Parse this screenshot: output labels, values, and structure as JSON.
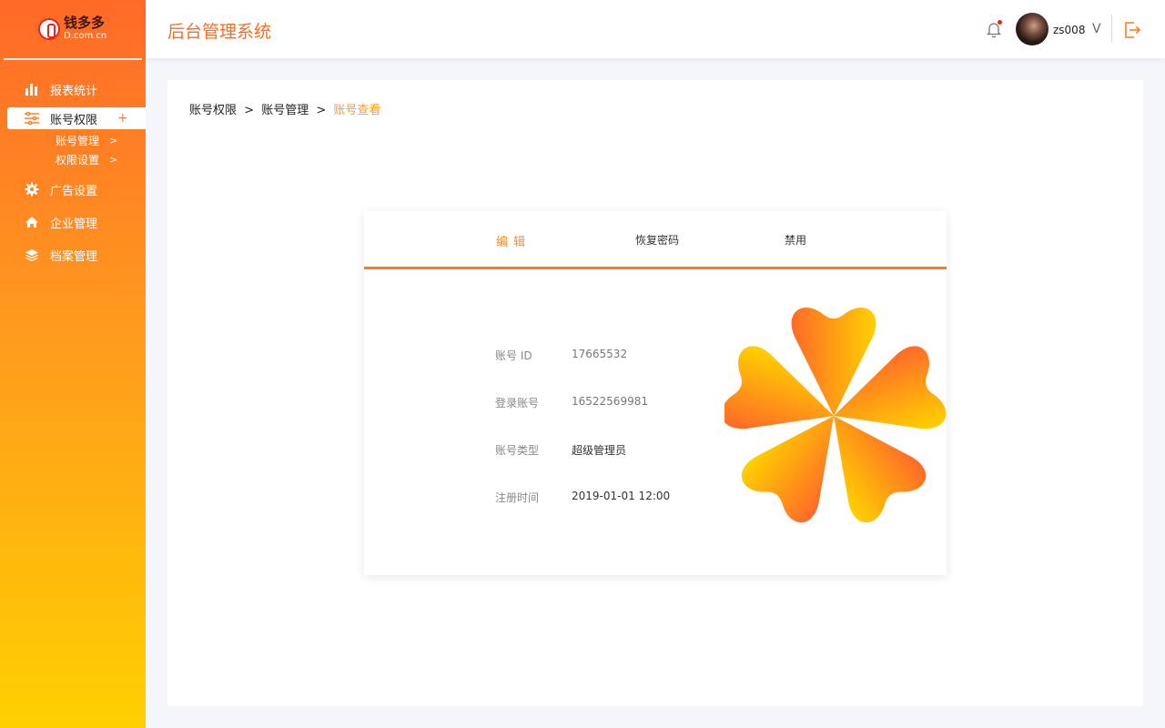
{
  "sidebar": {
    "logo_name": "钱多多",
    "logo_domain": "D.com.cn",
    "items": [
      {
        "label": "报表统计",
        "icon": "bar-chart-icon"
      },
      {
        "label": "账号权限",
        "icon": "sliders-icon",
        "active": true,
        "plus": "+"
      },
      {
        "label": "广告设置",
        "icon": "gear-icon"
      },
      {
        "label": "企业管理",
        "icon": "home-icon"
      },
      {
        "label": "档案管理",
        "icon": "layers-icon"
      }
    ],
    "subitems": [
      {
        "label": "账号管理",
        "chevron": ">"
      },
      {
        "label": "权限设置",
        "chevron": ">"
      }
    ]
  },
  "header": {
    "title": "后台管理系统",
    "username": "zs008",
    "caret": "V"
  },
  "breadcrumb": {
    "level1": "账号权限",
    "level2": "账号管理",
    "current": "账号查看",
    "separator": ">"
  },
  "card": {
    "tabs": {
      "edit": "编辑",
      "reset_password": "恢复密码",
      "disable": "禁用"
    },
    "fields": [
      {
        "key": "账号 ID",
        "value": "17665532"
      },
      {
        "key": "登录账号",
        "value": "16522569981"
      },
      {
        "key": "账号类型",
        "value": "超级管理员"
      },
      {
        "key": "注册时间",
        "value": "2019-01-01 12:00"
      }
    ]
  },
  "colors": {
    "accent": "#ff7a1a",
    "gradient_top": "#ff6a28",
    "gradient_bottom": "#ffd000",
    "notification_dot": "#e8241b"
  }
}
